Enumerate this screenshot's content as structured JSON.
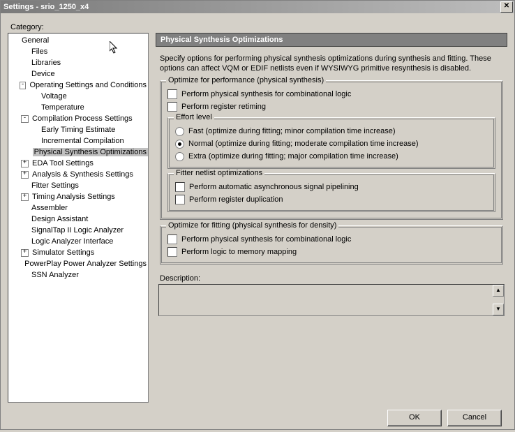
{
  "window": {
    "title": "Settings - srio_1250_x4"
  },
  "category_label": "Category:",
  "tree": [
    {
      "label": "General",
      "depth": 0,
      "toggle": null
    },
    {
      "label": "Files",
      "depth": 1,
      "toggle": null
    },
    {
      "label": "Libraries",
      "depth": 1,
      "toggle": null
    },
    {
      "label": "Device",
      "depth": 1,
      "toggle": null
    },
    {
      "label": "Operating Settings and Conditions",
      "depth": 1,
      "toggle": "-"
    },
    {
      "label": "Voltage",
      "depth": 2,
      "toggle": null
    },
    {
      "label": "Temperature",
      "depth": 2,
      "toggle": null
    },
    {
      "label": "Compilation Process Settings",
      "depth": 1,
      "toggle": "-"
    },
    {
      "label": "Early Timing Estimate",
      "depth": 2,
      "toggle": null
    },
    {
      "label": "Incremental Compilation",
      "depth": 2,
      "toggle": null
    },
    {
      "label": "Physical Synthesis Optimizations",
      "depth": 2,
      "toggle": null,
      "selected": true
    },
    {
      "label": "EDA Tool Settings",
      "depth": 1,
      "toggle": "+"
    },
    {
      "label": "Analysis & Synthesis Settings",
      "depth": 1,
      "toggle": "+"
    },
    {
      "label": "Fitter Settings",
      "depth": 1,
      "toggle": null
    },
    {
      "label": "Timing Analysis Settings",
      "depth": 1,
      "toggle": "+"
    },
    {
      "label": "Assembler",
      "depth": 1,
      "toggle": null
    },
    {
      "label": "Design Assistant",
      "depth": 1,
      "toggle": null
    },
    {
      "label": "SignalTap II Logic Analyzer",
      "depth": 1,
      "toggle": null
    },
    {
      "label": "Logic Analyzer Interface",
      "depth": 1,
      "toggle": null
    },
    {
      "label": "Simulator Settings",
      "depth": 1,
      "toggle": "+"
    },
    {
      "label": "PowerPlay Power Analyzer Settings",
      "depth": 1,
      "toggle": null
    },
    {
      "label": "SSN Analyzer",
      "depth": 1,
      "toggle": null
    }
  ],
  "panel": {
    "heading": "Physical Synthesis Optimizations",
    "intro": "Specify options for performing physical synthesis optimizations during synthesis and fitting. These options can affect VQM or EDIF netlists even if WYSIWYG primitive resynthesis is disabled.",
    "group_perf": {
      "legend": "Optimize for performance (physical synthesis)",
      "chk_comb": "Perform physical synthesis for combinational logic",
      "chk_retime": "Perform register retiming",
      "effort": {
        "legend": "Effort level",
        "fast": "Fast (optimize during fitting; minor compilation time increase)",
        "normal": "Normal (optimize during fitting; moderate compilation time increase)",
        "extra": "Extra (optimize during fitting; major compilation time increase)"
      },
      "fitter": {
        "legend": "Fitter netlist optimizations",
        "pipe": "Perform automatic asynchronous signal pipelining",
        "dup": "Perform register duplication"
      }
    },
    "group_fit": {
      "legend": "Optimize for fitting (physical synthesis for density)",
      "chk_comb": "Perform physical synthesis for combinational logic",
      "chk_mem": "Perform logic to memory mapping"
    },
    "desc_label": "Description:"
  },
  "buttons": {
    "ok": "OK",
    "cancel": "Cancel"
  }
}
